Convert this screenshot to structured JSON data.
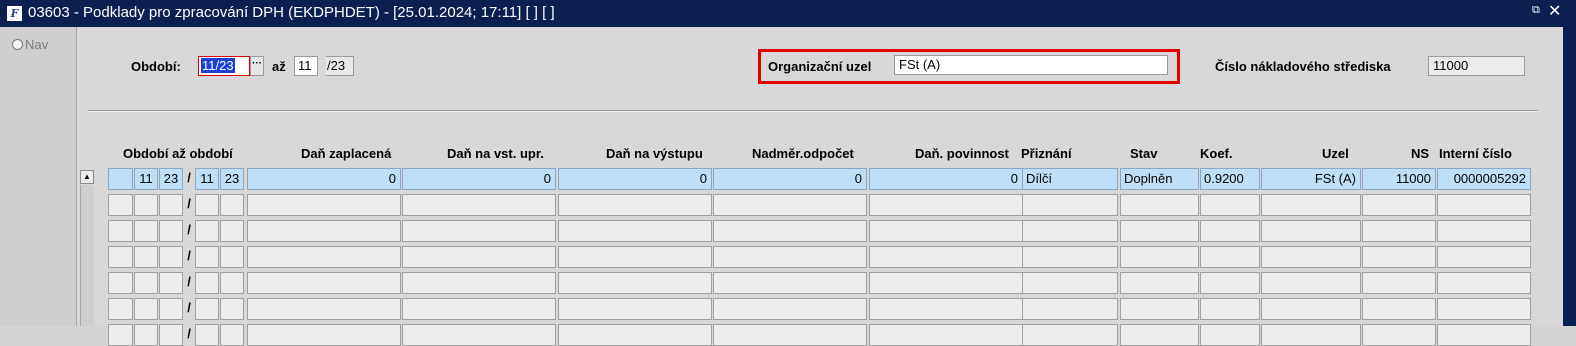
{
  "window": {
    "title": "03603 - Podklady pro zpracování DPH (EKDPHDET) - [25.01.2024; 17:11]  [ ]  [ ]",
    "icon_letter": "F",
    "restore_glyph": "⧉",
    "close_glyph": "✕"
  },
  "nav": {
    "label": "Nav"
  },
  "form": {
    "obdobi_label": "Období:",
    "obdobi_value": "11/23",
    "lov_glyph": "···",
    "az_label": "až",
    "az_month": "11",
    "az_year": "/23",
    "org_label": "Organizační uzel",
    "org_value": "FSt (A)",
    "cislo_label": "Číslo nákladového střediska",
    "cislo_value": "11000"
  },
  "table": {
    "headers": {
      "obdobi_az": "Období až období",
      "dan_zaplacena": "Daň zaplacená",
      "dan_na_vst": "Daň na vst. upr.",
      "dan_na_vystupu": "Daň na výstupu",
      "nadmer": "Nadměr.odpočet",
      "dan_povinnost": "Daň. povinnost",
      "priznani": "Přiznání",
      "stav": "Stav",
      "koef": "Koef.",
      "uzel": "Uzel",
      "ns": "NS",
      "interni_cislo": "Interní číslo"
    },
    "separator": "/",
    "row1": {
      "od_mesic": "11",
      "od_rok": "23",
      "do_mesic": "11",
      "do_rok": "23",
      "dan_zaplacena": "0",
      "dan_na_vst": "0",
      "dan_na_vystupu": "0",
      "nadmer": "0",
      "dan_povinnost": "0",
      "priznani": "Dílčí",
      "stav": "Doplněn",
      "koef": "0.9200",
      "uzel": "FSt (A)",
      "ns": "11000",
      "interni_cislo": "0000005292"
    }
  },
  "colors": {
    "titlebar": "#0a2050",
    "selected_row": "#bde0f8",
    "highlight_box": "#e00000",
    "text_selection": "#1c3fd8"
  }
}
